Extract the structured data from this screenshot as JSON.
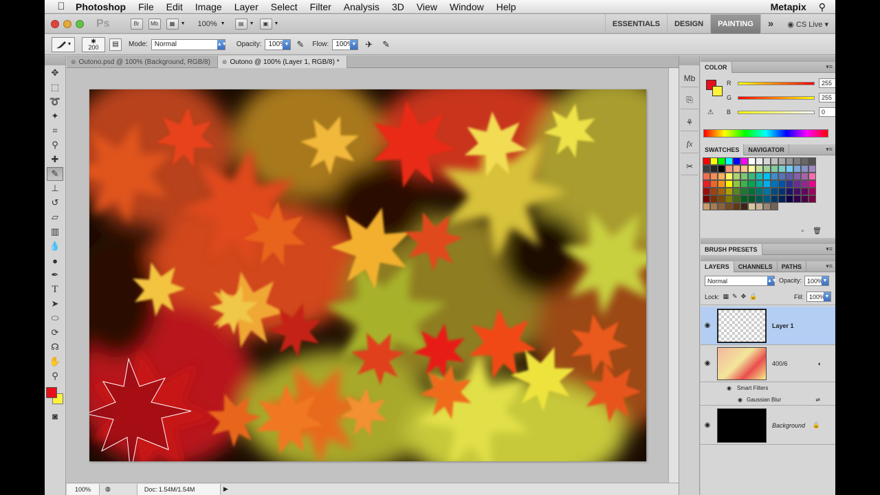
{
  "menubar": {
    "app_name": "Photoshop",
    "items": [
      "File",
      "Edit",
      "Image",
      "Layer",
      "Select",
      "Filter",
      "Analysis",
      "3D",
      "View",
      "Window",
      "Help"
    ],
    "user": "Metapix",
    "search_icon": "search-icon"
  },
  "appbar": {
    "logo": "Ps",
    "bridge_label": "Br",
    "minibridge_label": "Mb",
    "zoom": "100%",
    "workspaces": [
      "ESSENTIALS",
      "DESIGN",
      "PAINTING"
    ],
    "active_workspace": "PAINTING",
    "more": "»",
    "cs_live": "CS Live"
  },
  "options": {
    "brush_size": "200",
    "mode_label": "Mode:",
    "mode_value": "Normal",
    "opacity_label": "Opacity:",
    "opacity_value": "100%",
    "flow_label": "Flow:",
    "flow_value": "100%"
  },
  "tabs": [
    {
      "label": "Outono.psd @ 100% (Background, RGB/8)",
      "active": false
    },
    {
      "label": "Outono @ 100% (Layer 1, RGB/8) *",
      "active": true
    }
  ],
  "status": {
    "zoom": "100%",
    "doc": "Doc: 1.54M/1.54M"
  },
  "color_panel": {
    "title": "COLOR",
    "channels": [
      {
        "label": "R",
        "value": "255"
      },
      {
        "label": "G",
        "value": "255"
      },
      {
        "label": "B",
        "value": "0"
      }
    ],
    "fg_color": "#e6101a",
    "bg_color": "#fff23b"
  },
  "swatches_panel": {
    "tabs": [
      "SWATCHES",
      "NAVIGATOR"
    ]
  },
  "brush_presets": {
    "title": "BRUSH PRESETS"
  },
  "layers_panel": {
    "tabs": [
      "LAYERS",
      "CHANNELS",
      "PATHS"
    ],
    "blend_mode": "Normal",
    "opacity_label": "Opacity:",
    "opacity_value": "100%",
    "lock_label": "Lock:",
    "fill_label": "Fill:",
    "fill_value": "100%",
    "layers": [
      {
        "name": "Layer 1",
        "selected": true
      },
      {
        "name": "400/6",
        "selected": false
      },
      {
        "name": "Background",
        "selected": false
      }
    ],
    "smart_filters_label": "Smart Filters",
    "gaussian_blur_label": "Gaussian Blur"
  }
}
